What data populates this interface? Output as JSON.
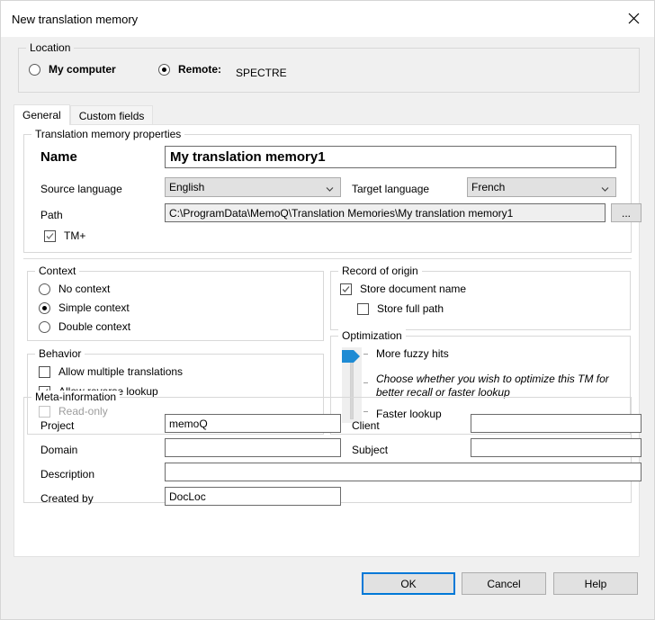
{
  "window": {
    "title": "New translation memory",
    "close_icon": "close-icon"
  },
  "location": {
    "legend": "Location",
    "options": [
      {
        "label": "My computer",
        "selected": false
      },
      {
        "label": "Remote:",
        "selected": true
      }
    ],
    "remote_server": "SPECTRE"
  },
  "tabs": [
    {
      "label": "General",
      "selected": true
    },
    {
      "label": "Custom fields",
      "selected": false
    }
  ],
  "properties": {
    "legend": "Translation memory properties",
    "name_label": "Name",
    "name_value": "My translation memory1",
    "source_language_label": "Source language",
    "source_language_value": "English",
    "target_language_label": "Target language",
    "target_language_value": "French",
    "path_label": "Path",
    "path_value": "C:\\ProgramData\\MemoQ\\Translation Memories\\My translation memory1",
    "browse_button": "...",
    "tmplus_label": "TM+",
    "tmplus_checked": true
  },
  "context": {
    "legend": "Context",
    "options": [
      {
        "label": "No context",
        "selected": false
      },
      {
        "label": "Simple context",
        "selected": true
      },
      {
        "label": "Double context",
        "selected": false
      }
    ]
  },
  "behavior": {
    "legend": "Behavior",
    "options": [
      {
        "label": "Allow multiple translations",
        "checked": false,
        "disabled": false
      },
      {
        "label": "Allow reverse lookup",
        "checked": true,
        "disabled": false
      },
      {
        "label": "Read-only",
        "checked": false,
        "disabled": true
      }
    ]
  },
  "record_of_origin": {
    "legend": "Record of origin",
    "options": [
      {
        "label": "Store document name",
        "checked": true,
        "disabled": false
      },
      {
        "label": "Store full path",
        "checked": false,
        "disabled": false
      }
    ]
  },
  "optimization": {
    "legend": "Optimization",
    "top_label": "More fuzzy hits",
    "hint": "Choose whether you wish to optimize this TM for better recall or faster lookup",
    "bottom_label": "Faster lookup",
    "slider_position": "top",
    "slider_color": "#1e8bd4"
  },
  "meta": {
    "legend": "Meta-information",
    "fields": [
      {
        "label": "Project",
        "value": "memoQ"
      },
      {
        "label": "Domain",
        "value": ""
      },
      {
        "label": "Description",
        "value": ""
      },
      {
        "label": "Created by",
        "value": "DocLoc"
      },
      {
        "label": "Client",
        "value": ""
      },
      {
        "label": "Subject",
        "value": ""
      }
    ]
  },
  "footer": {
    "ok": "OK",
    "cancel": "Cancel",
    "help": "Help"
  },
  "colors": {
    "accent": "#0078d7",
    "dialog_background": "#f0f0f0",
    "panel_background": "#ffffff",
    "control_background": "#e1e1e1"
  }
}
